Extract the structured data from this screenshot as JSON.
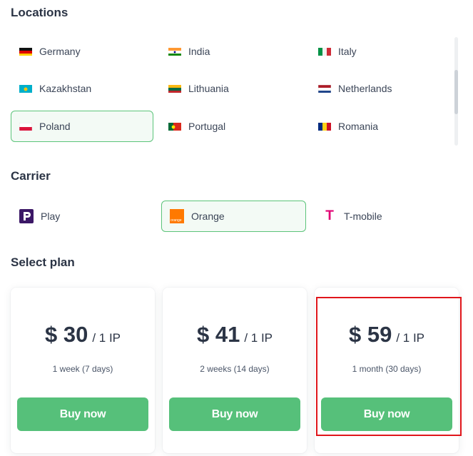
{
  "locations": {
    "title": "Locations",
    "items": [
      {
        "label": "Germany",
        "flag": "germany-flag"
      },
      {
        "label": "India",
        "flag": "india-flag"
      },
      {
        "label": "Italy",
        "flag": "italy-flag"
      },
      {
        "label": "Kazakhstan",
        "flag": "kazakhstan-flag"
      },
      {
        "label": "Lithuania",
        "flag": "lithuania-flag"
      },
      {
        "label": "Netherlands",
        "flag": "netherlands-flag"
      },
      {
        "label": "Poland",
        "flag": "poland-flag",
        "selected": true
      },
      {
        "label": "Portugal",
        "flag": "portugal-flag"
      },
      {
        "label": "Romania",
        "flag": "romania-flag"
      }
    ]
  },
  "carrier": {
    "title": "Carrier",
    "items": [
      {
        "label": "Play",
        "icon": "play-logo-icon"
      },
      {
        "label": "Orange",
        "icon": "orange-logo-icon",
        "selected": true,
        "logo_text": "orange"
      },
      {
        "label": "T-mobile",
        "icon": "t-mobile-logo-icon",
        "logo_text": "T"
      }
    ]
  },
  "plans": {
    "title": "Select plan",
    "items": [
      {
        "price": "$ 30",
        "per": "/ 1 IP",
        "duration": "1 week (7 days)",
        "button": "Buy now"
      },
      {
        "price": "$ 41",
        "per": "/ 1 IP",
        "duration": "2 weeks (14 days)",
        "button": "Buy now"
      },
      {
        "price": "$ 59",
        "per": "/ 1 IP",
        "duration": "1 month (30 days)",
        "button": "Buy now",
        "highlighted": true
      }
    ]
  },
  "colors": {
    "accent_green": "#56c07a",
    "selected_border": "#5cc47a",
    "highlight_red": "#e0161b",
    "heading": "#2b3445"
  }
}
